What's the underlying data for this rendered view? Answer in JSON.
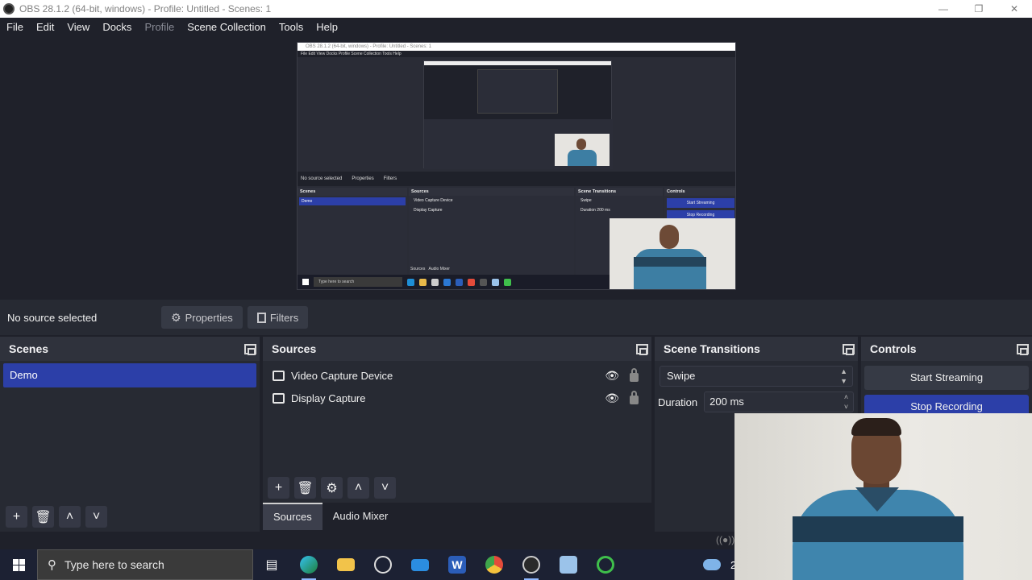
{
  "window": {
    "title": "OBS 28.1.2 (64-bit, windows) - Profile: Untitled - Scenes: 1",
    "controls": [
      "minimize",
      "restore",
      "close"
    ]
  },
  "menu": {
    "items": [
      "File",
      "Edit",
      "View",
      "Docks",
      "Profile",
      "Scene Collection",
      "Tools",
      "Help"
    ]
  },
  "preview": {
    "title": "OBS 28.1.2 (64-bit, windows) - Profile: Untitled - Scenes: 1",
    "menu": "File  Edit  View  Docks  Profile  Scene Collection  Tools  Help",
    "no_source": "No source selected",
    "properties": "Properties",
    "filters": "Filters",
    "scenes_title": "Scenes",
    "scene_item": "Demo",
    "sources_title": "Sources",
    "source_1": "Video Capture Device",
    "source_2": "Display Capture",
    "transitions_title": "Scene Transitions",
    "transition": "Swipe",
    "duration": "Duration",
    "duration_value": "200 ms",
    "controls_title": "Controls",
    "start_streaming": "Start Streaming",
    "stop_recording": "Stop Recording",
    "tab_sources": "Sources",
    "tab_mixer": "Audio Mixer",
    "search": "Type here to search"
  },
  "source_bar": {
    "no_source": "No source selected",
    "properties": "Properties",
    "filters": "Filters"
  },
  "scenes": {
    "title": "Scenes",
    "items": [
      "Demo"
    ]
  },
  "sources": {
    "title": "Sources",
    "items": [
      {
        "label": "Video Capture Device",
        "icon": "camera-icon"
      },
      {
        "label": "Display Capture",
        "icon": "monitor-icon"
      }
    ]
  },
  "tabs": [
    "Sources",
    "Audio Mixer"
  ],
  "transitions": {
    "title": "Scene Transitions",
    "selected": "Swipe",
    "duration_label": "Duration",
    "duration_value": "200 ms"
  },
  "controls": {
    "title": "Controls",
    "start_streaming": "Start Streaming",
    "stop_recording": "Stop Recording"
  },
  "taskbar": {
    "search_placeholder": "Type here to search",
    "tray_fragment": "2"
  },
  "colors": {
    "accent": "#2c3fa8",
    "background": "#1f212a",
    "dock": "#272a33"
  }
}
